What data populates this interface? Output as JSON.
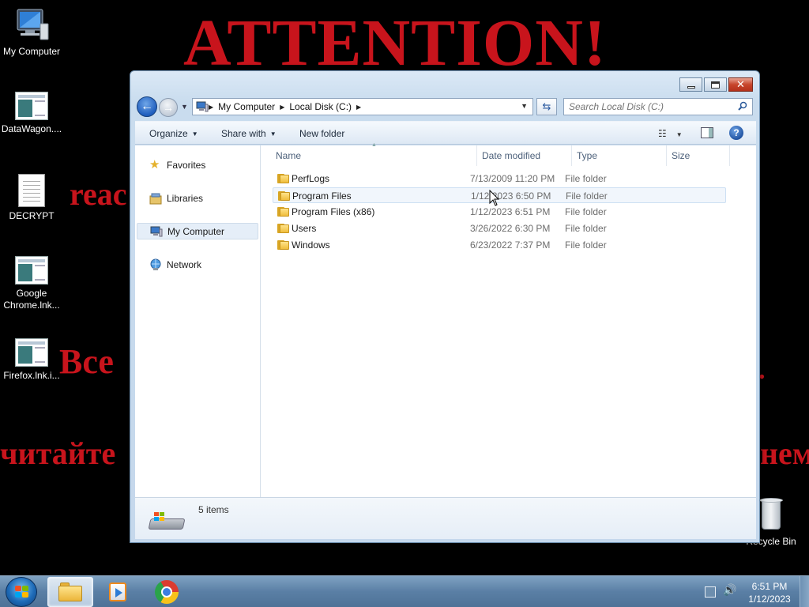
{
  "wallpaper": {
    "title": "ATTENTION!",
    "line1": "reac",
    "line2": "Все",
    "line3": ".",
    "line4": "читайте",
    "line5": "нем"
  },
  "desktop_icons": [
    {
      "label": "My Computer"
    },
    {
      "label": "DataWagon...."
    },
    {
      "label": "DECRYPT"
    },
    {
      "label": "Google Chrome.lnk..."
    },
    {
      "label": "Firefox.lnk.i..."
    }
  ],
  "recycle_bin": {
    "label": "Recycle Bin"
  },
  "explorer": {
    "address": {
      "crumbs": [
        "My Computer",
        "Local Disk (C:)"
      ]
    },
    "search": {
      "placeholder": "Search Local Disk (C:)"
    },
    "toolbar": {
      "organize": "Organize",
      "share_with": "Share with",
      "new_folder": "New folder"
    },
    "nav": {
      "favorites": "Favorites",
      "libraries": "Libraries",
      "my_computer": "My Computer",
      "network": "Network"
    },
    "columns": {
      "name": "Name",
      "date": "Date modified",
      "type": "Type",
      "size": "Size"
    },
    "files": [
      {
        "name": "PerfLogs",
        "date": "7/13/2009 11:20 PM",
        "type": "File folder"
      },
      {
        "name": "Program Files",
        "date": "1/12/2023 6:50 PM",
        "type": "File folder"
      },
      {
        "name": "Program Files (x86)",
        "date": "1/12/2023 6:51 PM",
        "type": "File folder"
      },
      {
        "name": "Users",
        "date": "3/26/2022 6:30 PM",
        "type": "File folder"
      },
      {
        "name": "Windows",
        "date": "6/23/2022 7:37 PM",
        "type": "File folder"
      }
    ],
    "status": {
      "count": "5 items"
    }
  },
  "taskbar": {
    "clock": {
      "time": "6:51 PM",
      "date": "1/12/2023"
    }
  },
  "colors": {
    "wallpaper_text": "#c8141c",
    "taskbar": "#5a7fa5",
    "selection": "#cde0f3"
  }
}
